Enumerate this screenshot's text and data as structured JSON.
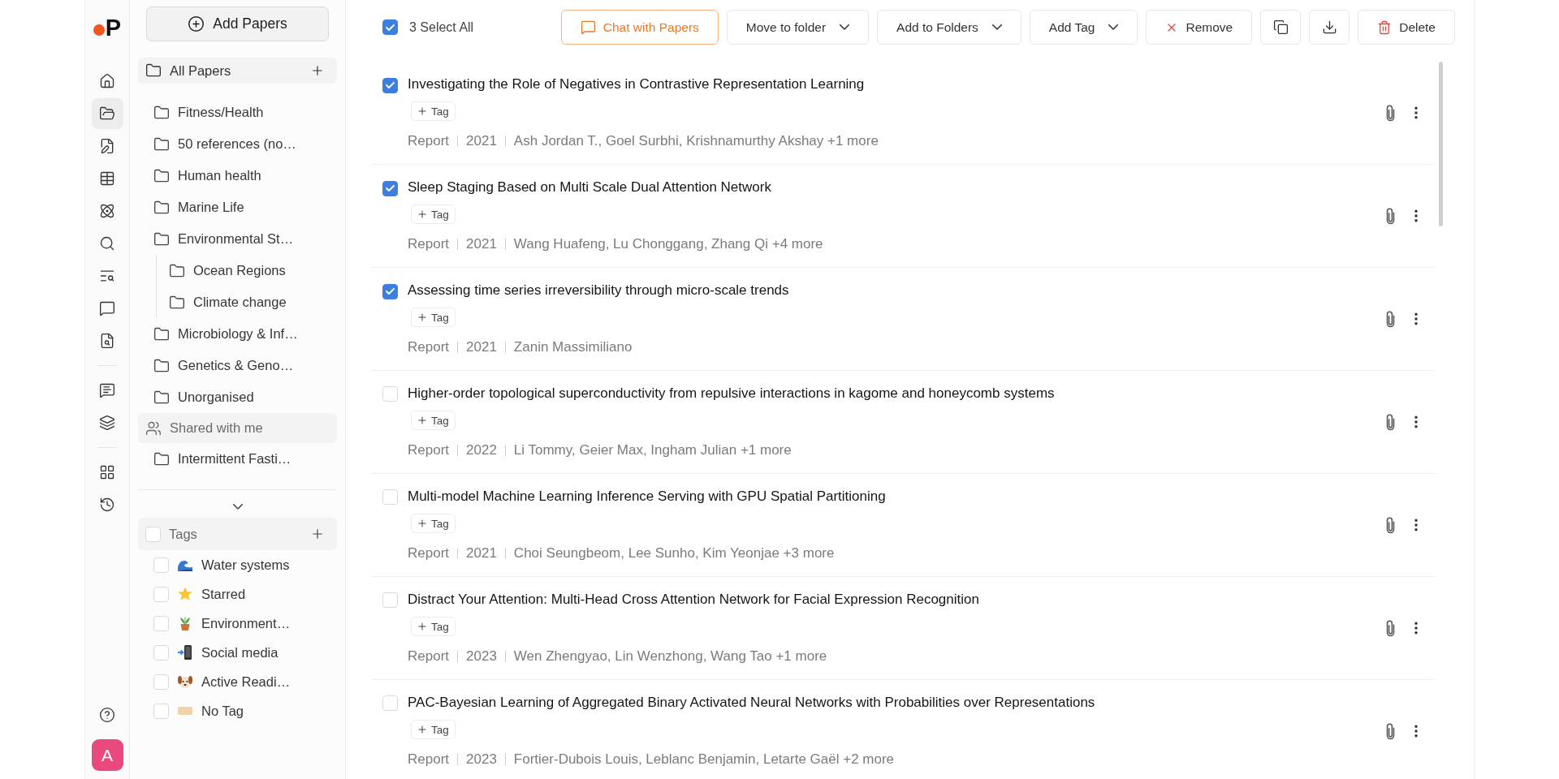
{
  "logo": {
    "text": "P"
  },
  "nav": {
    "groups": [
      {
        "items": [
          {
            "kind": "home",
            "selected": false
          },
          {
            "kind": "folders",
            "selected": true
          },
          {
            "kind": "file-pen",
            "selected": false
          },
          {
            "kind": "table",
            "selected": false
          },
          {
            "kind": "atom",
            "selected": false
          },
          {
            "kind": "search",
            "selected": false
          },
          {
            "kind": "text-search",
            "selected": false
          },
          {
            "kind": "message",
            "selected": false
          },
          {
            "kind": "file-search",
            "selected": false
          }
        ]
      },
      {
        "items": [
          {
            "kind": "message-text",
            "selected": false
          },
          {
            "kind": "layers",
            "selected": false
          }
        ]
      },
      {
        "items": [
          {
            "kind": "grid",
            "selected": false
          },
          {
            "kind": "history",
            "selected": false
          }
        ]
      }
    ]
  },
  "avatar": {
    "initial": "A"
  },
  "sidebar": {
    "add_button": "Add Papers",
    "folders_header": "All Papers",
    "folders": [
      {
        "name": "Fitness/Health"
      },
      {
        "name": "50 references (no…"
      },
      {
        "name": "Human health"
      },
      {
        "name": "Marine Life"
      },
      {
        "name": "Environmental St…",
        "children": [
          {
            "name": "Ocean Regions"
          },
          {
            "name": "Climate change"
          }
        ]
      },
      {
        "name": "Microbiology & Inf…"
      },
      {
        "name": "Genetics & Geno…"
      },
      {
        "name": "Unorganised"
      }
    ],
    "shared": {
      "label": "Shared with me",
      "folders": [
        {
          "name": "Intermittent Fasti…"
        }
      ]
    },
    "tags": {
      "label": "Tags",
      "checked": false,
      "items": [
        {
          "name": "Water systems",
          "kind": "wave",
          "checked": false
        },
        {
          "name": "Starred",
          "kind": "star",
          "checked": false
        },
        {
          "name": "Environment…",
          "kind": "plant",
          "checked": false
        },
        {
          "name": "Social media",
          "kind": "phone",
          "checked": false
        },
        {
          "name": "Active Readi…",
          "kind": "dog",
          "checked": false
        },
        {
          "name": "No Tag",
          "kind": "label",
          "checked": false
        }
      ]
    }
  },
  "toolbar": {
    "select_all": {
      "label": "3 Select All",
      "checked": true
    },
    "buttons": [
      {
        "kind": "chat",
        "label": "Chat with Papers"
      },
      {
        "kind": "menu",
        "label": "Move to folder"
      },
      {
        "kind": "menu",
        "label": "Add to Folders"
      },
      {
        "kind": "menu",
        "label": "Add Tag"
      },
      {
        "kind": "remove",
        "label": "Remove"
      },
      {
        "kind": "copy"
      },
      {
        "kind": "download"
      },
      {
        "kind": "delete",
        "label": "Delete"
      }
    ]
  },
  "papers": [
    {
      "title": "Investigating the Role of Negatives in Contrastive Representation Learning",
      "checked": true,
      "tag_button": "Tag",
      "type": "Report",
      "year": "2021",
      "authors": "Ash Jordan T., Goel Surbhi, Krishnamurthy Akshay +1 more"
    },
    {
      "title": "Sleep Staging Based on Multi Scale Dual Attention Network",
      "checked": true,
      "tag_button": "Tag",
      "type": "Report",
      "year": "2021",
      "authors": "Wang Huafeng, Lu Chonggang, Zhang Qi +4 more"
    },
    {
      "title": "Assessing time series irreversibility through micro-scale trends",
      "checked": true,
      "tag_button": "Tag",
      "type": "Report",
      "year": "2021",
      "authors": "Zanin Massimiliano"
    },
    {
      "title": "Higher-order topological superconductivity from repulsive interactions in kagome and honeycomb systems",
      "checked": false,
      "tag_button": "Tag",
      "type": "Report",
      "year": "2022",
      "authors": "Li Tommy, Geier Max, Ingham Julian +1 more"
    },
    {
      "title": "Multi-model Machine Learning Inference Serving with GPU Spatial Partitioning",
      "checked": false,
      "tag_button": "Tag",
      "type": "Report",
      "year": "2021",
      "authors": "Choi Seungbeom, Lee Sunho, Kim Yeonjae +3 more"
    },
    {
      "title": "Distract Your Attention: Multi-Head Cross Attention Network for Facial Expression Recognition",
      "checked": false,
      "tag_button": "Tag",
      "type": "Report",
      "year": "2023",
      "authors": "Wen Zhengyao, Lin Wenzhong, Wang Tao +1 more"
    },
    {
      "title": "PAC-Bayesian Learning of Aggregated Binary Activated Neural Networks with Probabilities over Representations",
      "checked": false,
      "tag_button": "Tag",
      "type": "Report",
      "year": "2023",
      "authors": "Fortier-Dubois Louis, Leblanc Benjamin, Letarte Gaël +2 more"
    }
  ]
}
